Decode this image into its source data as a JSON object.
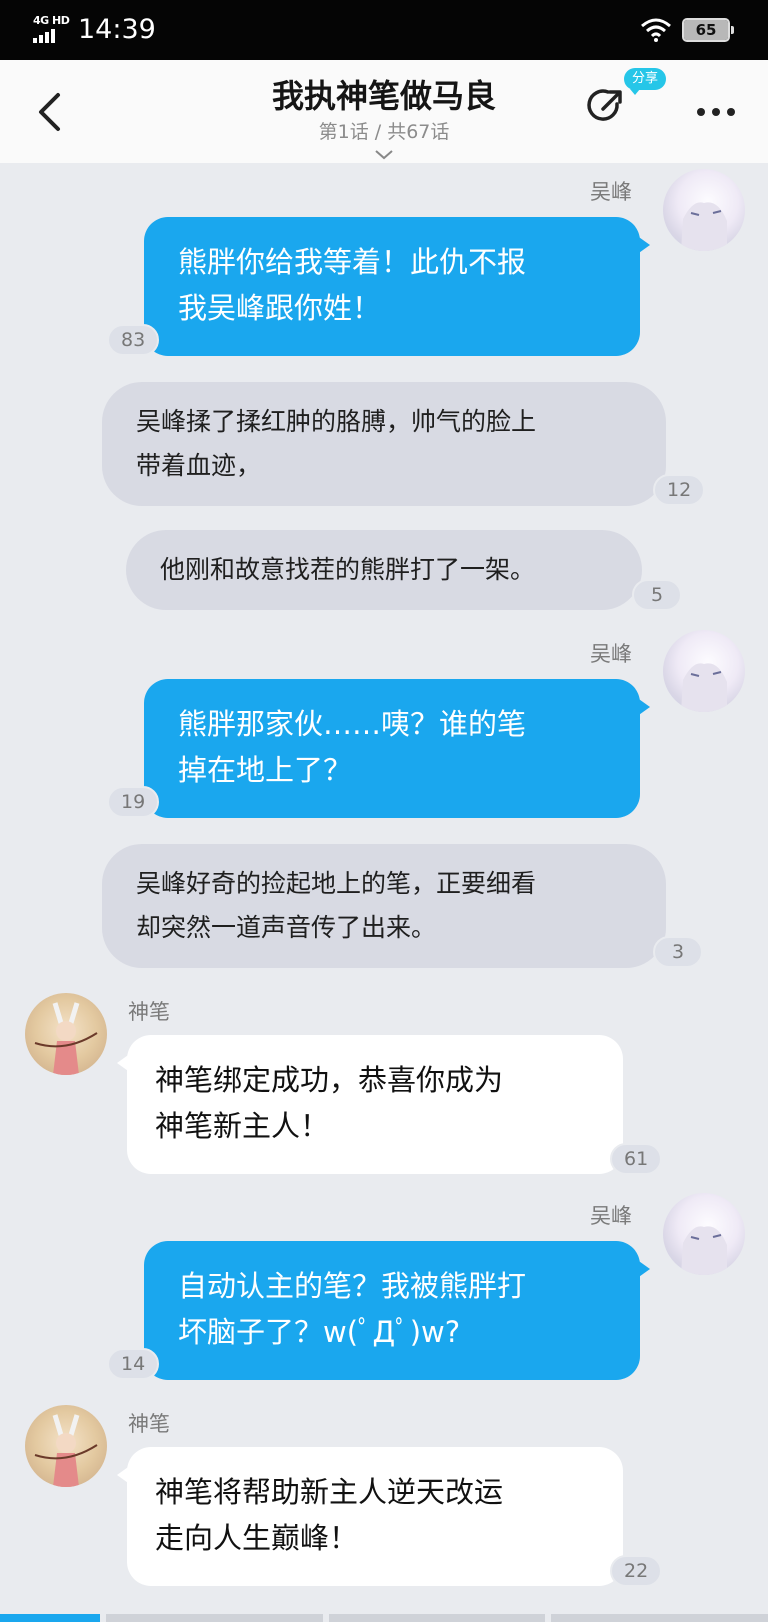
{
  "status_bar": {
    "network": "4G HD",
    "time": "14:39",
    "battery": "65"
  },
  "header": {
    "title": "我执神笔做马良",
    "subtitle": "第1话 / 共67话",
    "share_badge": "分享",
    "icons": [
      "back-arrow-icon",
      "share-icon",
      "more-icon",
      "chevron-down-icon"
    ]
  },
  "messages": [
    {
      "type": "right",
      "sender": "吴峰",
      "text_lines": [
        "熊胖你给我等着！此仇不报",
        "我吴峰跟你姓！"
      ],
      "count": "83"
    },
    {
      "type": "narration",
      "text_lines": [
        "吴峰揉了揉红肿的胳膊，帅气的脸上",
        "带着血迹，"
      ],
      "count": "12"
    },
    {
      "type": "narration",
      "text_lines": [
        "他刚和故意找茬的熊胖打了一架。"
      ],
      "count": "5"
    },
    {
      "type": "right",
      "sender": "吴峰",
      "text_lines": [
        "熊胖那家伙……咦？谁的笔",
        "掉在地上了？"
      ],
      "count": "19"
    },
    {
      "type": "narration",
      "text_lines": [
        "吴峰好奇的捡起地上的笔，正要细看",
        "却突然一道声音传了出来。"
      ],
      "count": "3"
    },
    {
      "type": "left",
      "sender": "神笔",
      "text_lines": [
        "神笔绑定成功，恭喜你成为",
        "神笔新主人！"
      ],
      "count": "61"
    },
    {
      "type": "right",
      "sender": "吴峰",
      "text_lines": [
        "自动认主的笔？我被熊胖打",
        "坏脑子了？w(ﾟДﾟ)w?"
      ],
      "count": "14"
    },
    {
      "type": "left",
      "sender": "神笔",
      "text_lines": [
        "神笔将帮助新主人逆天改运",
        "走向人生巅峰！"
      ],
      "count": "22"
    }
  ],
  "colors": {
    "background": "#e9ebef",
    "right_bubble": "#1aa7ee",
    "narration_bubble": "#d8dae3",
    "left_bubble": "#ffffff",
    "accent": "#26c6e8"
  }
}
